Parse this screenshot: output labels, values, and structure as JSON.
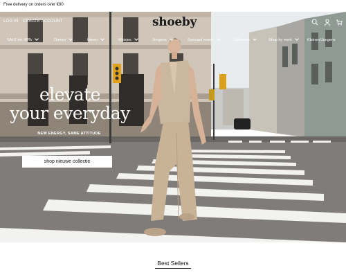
{
  "announcement": {
    "text": "Free delivery on orders over €80"
  },
  "header": {
    "login_label": "LOG IN",
    "create_account_label": "CREATE ACCOUNT",
    "logo": "shoeby",
    "icons": [
      "search-icon",
      "account-icon",
      "cart-icon"
    ]
  },
  "menu": {
    "items": [
      {
        "label": "SALE tot -80%",
        "has_dropdown": true
      },
      {
        "label": "Dames",
        "has_dropdown": true
      },
      {
        "label": "Heren",
        "has_dropdown": true
      },
      {
        "label": "Meisjes",
        "has_dropdown": true
      },
      {
        "label": "Jongens",
        "has_dropdown": true
      },
      {
        "label": "Speciaal maten",
        "has_dropdown": true
      },
      {
        "label": "Collecties",
        "has_dropdown": true
      },
      {
        "label": "Shop by merk",
        "has_dropdown": true
      },
      {
        "label": "Kleinen/Jongens",
        "has_dropdown": false
      }
    ]
  },
  "hero": {
    "headline_line1": "elevate",
    "headline_line2": "your everyday",
    "tagline": "NEW ENERGY, SAME ATTITUDE",
    "cta_label": "shop nieuwe collectie"
  },
  "best_sellers": {
    "title": "Best Sellers"
  },
  "colors": {
    "text_dark": "#111111",
    "cta_bg": "#ffffff",
    "hero_white_text": "#ffffff"
  }
}
